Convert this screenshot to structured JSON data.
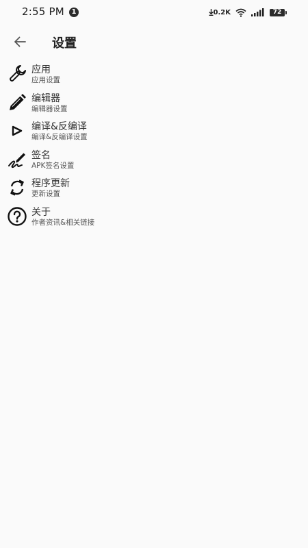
{
  "status_bar": {
    "time": "2:55 PM",
    "notification_count": "1",
    "net_speed": "0.2K",
    "battery": "72"
  },
  "toolbar": {
    "title": "设置"
  },
  "settings": {
    "items": [
      {
        "title": "应用",
        "subtitle": "应用设置",
        "icon": "wrench-icon"
      },
      {
        "title": "编辑器",
        "subtitle": "编辑器设置",
        "icon": "pencil-icon"
      },
      {
        "title": "编译&反编译",
        "subtitle": "编译&反编译设置",
        "icon": "play-triangle-icon"
      },
      {
        "title": "签名",
        "subtitle": "APK签名设置",
        "icon": "signature-icon"
      },
      {
        "title": "程序更新",
        "subtitle": "更新设置",
        "icon": "sync-icon"
      },
      {
        "title": "关于",
        "subtitle": "作者资讯&相关链接",
        "icon": "help-circle-icon"
      }
    ]
  }
}
